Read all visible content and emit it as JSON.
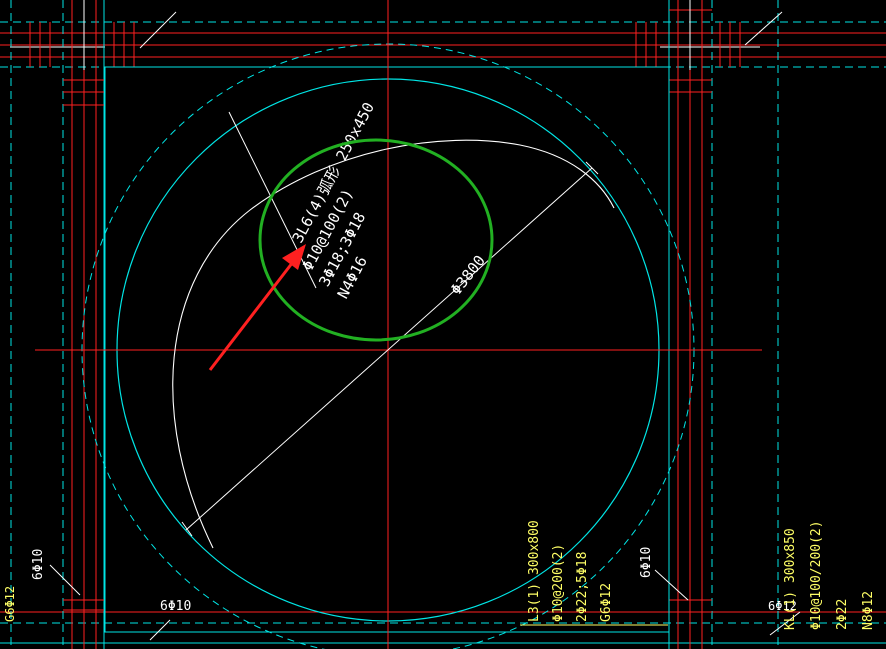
{
  "beam_label": {
    "line1": "3L6(4)弧形 250x450",
    "line2": "Φ10@100(2)",
    "line3": "3Φ18;3Φ18",
    "line4": "N4Φ16"
  },
  "diameter_label": "Φ3800",
  "rebar_labels": {
    "left_vertical": "6Φ10",
    "left_edge": "G6Φ12",
    "bottom_left": "6Φ10",
    "right_vertical": "6Φ10",
    "right_small": "6Φ12"
  },
  "beam_l3": {
    "line1": "L3(1) 300x800",
    "line2": "Φ10@200(2)",
    "line3": "2Φ22;5Φ18",
    "line4": "G6Φ12"
  },
  "beam_kl": {
    "line1": "KL(1) 300x850",
    "line2": "Φ10@100/200(2)",
    "line3": "2Φ22",
    "line4": "N8Φ12"
  },
  "colors": {
    "background": "#000000",
    "axis": "#ff2020",
    "outline": "#00e5e5",
    "arc": "#ffffff",
    "highlight_circle": "#22b022",
    "arrow": "#ff2020",
    "yellow_text": "#ffff66"
  }
}
